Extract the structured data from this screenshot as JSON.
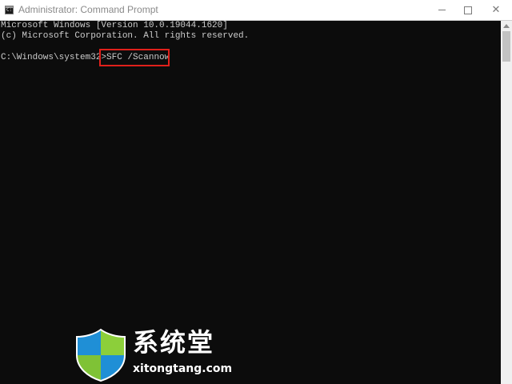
{
  "window": {
    "title": "Administrator: Command Prompt",
    "icon": "cmd-icon",
    "controls": [
      "minimize-icon",
      "maximize-icon",
      "close-icon"
    ]
  },
  "console": {
    "lines": [
      "Microsoft Windows [Version 10.0.19044.1620]",
      "(c) Microsoft Corporation. All rights reserved."
    ],
    "prompt": "C:\\Windows\\system32>",
    "command": "SFC /Scannow",
    "highlight_color": "#e0201b"
  },
  "watermark": {
    "title": "系统堂",
    "url": "xitongtang.com"
  },
  "colors": {
    "console_bg": "#0c0c0c",
    "console_text": "#cccccc",
    "titlebar_bg": "#ffffff"
  }
}
